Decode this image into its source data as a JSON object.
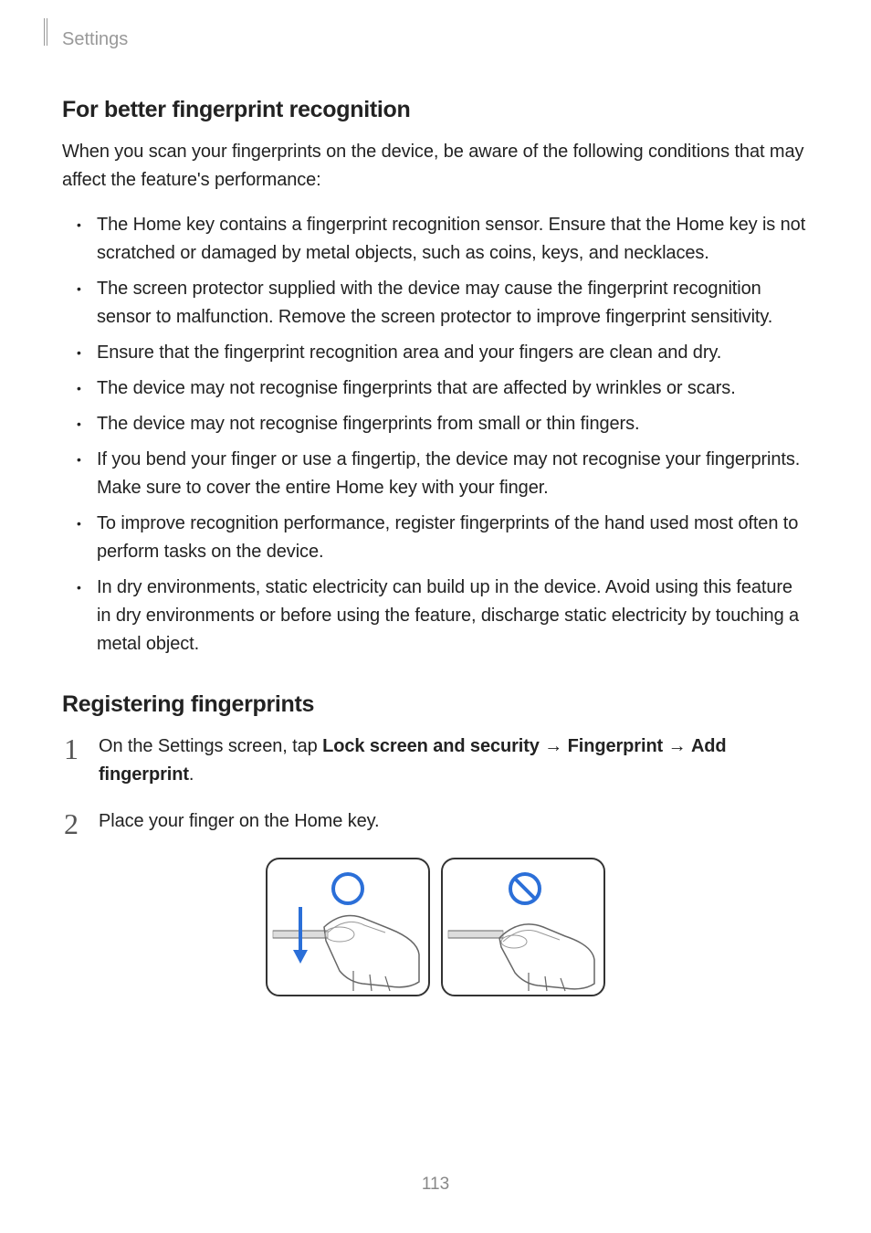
{
  "header": "Settings",
  "section1": {
    "heading": "For better fingerprint recognition",
    "intro": "When you scan your fingerprints on the device, be aware of the following conditions that may affect the feature's performance:",
    "bullets": [
      "The Home key contains a fingerprint recognition sensor. Ensure that the Home key is not scratched or damaged by metal objects, such as coins, keys, and necklaces.",
      "The screen protector supplied with the device may cause the fingerprint recognition sensor to malfunction. Remove the screen protector to improve fingerprint sensitivity.",
      "Ensure that the fingerprint recognition area and your fingers are clean and dry.",
      "The device may not recognise fingerprints that are affected by wrinkles or scars.",
      "The device may not recognise fingerprints from small or thin fingers.",
      "If you bend your finger or use a fingertip, the device may not recognise your fingerprints. Make sure to cover the entire Home key with your finger.",
      "To improve recognition performance, register fingerprints of the hand used most often to perform tasks on the device.",
      "In dry environments, static electricity can build up in the device. Avoid using this feature in dry environments or before using the feature, discharge static electricity by touching a metal object."
    ]
  },
  "section2": {
    "heading": "Registering fingerprints",
    "step1": {
      "prefix": "On the Settings screen, tap ",
      "b1": "Lock screen and security",
      "arrow1": " → ",
      "b2": "Fingerprint",
      "arrow2": " → ",
      "b3": "Add fingerprint",
      "suffix": "."
    },
    "step2": "Place your finger on the Home key."
  },
  "pageNumber": "113"
}
